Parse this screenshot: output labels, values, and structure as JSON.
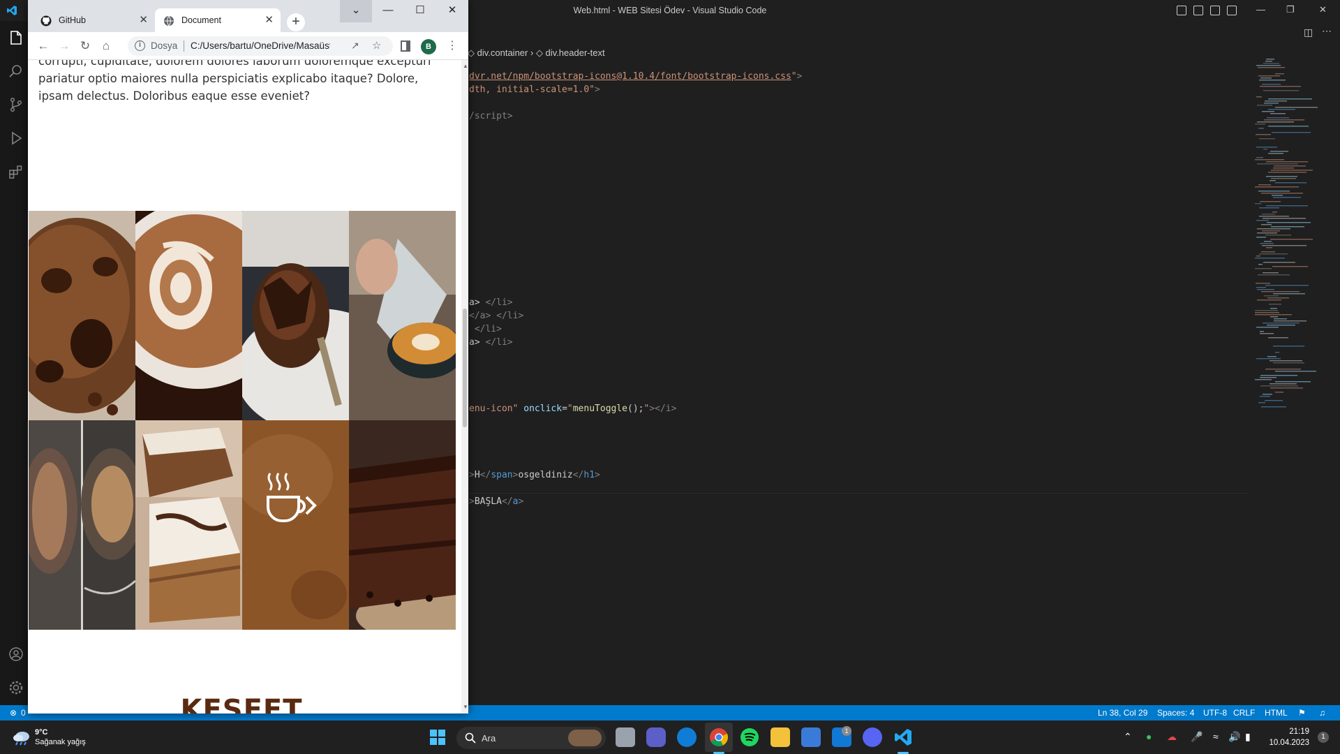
{
  "vscode": {
    "title": "Web.html - WEB Sitesi Ödev - Visual Studio Code",
    "breadcrumb": [
      "div.container",
      "div.header-text"
    ],
    "code_lines": [
      {
        "segments": [
          [
            "url",
            "dvr.net/npm/bootstrap-icons@1.10.4/font/bootstrap-icons.css"
          ],
          [
            "str",
            "\""
          ],
          [
            "tag",
            ">"
          ]
        ]
      },
      {
        "segments": [
          [
            "str",
            "dth, initial-scale=1.0\""
          ],
          [
            "tag",
            ">"
          ]
        ]
      },
      {
        "segments": [
          [
            "tag",
            "/script>"
          ]
        ]
      },
      {
        "segments": [
          [
            "plain",
            "a> "
          ],
          [
            "tag",
            "</li>"
          ]
        ]
      },
      {
        "segments": [
          [
            "tag",
            "</a> </li>"
          ]
        ]
      },
      {
        "segments": [
          [
            "tag",
            " </li>"
          ]
        ]
      },
      {
        "segments": [
          [
            "plain",
            "a> "
          ],
          [
            "tag",
            "</li>"
          ]
        ]
      },
      {
        "segments": [
          [
            "str",
            "enu-icon\" "
          ],
          [
            "attr",
            "onclick"
          ],
          [
            "plain",
            "="
          ],
          [
            "str",
            "\""
          ],
          [
            "fn",
            "menuToggle"
          ],
          [
            "plain",
            "();"
          ],
          [
            "str",
            "\""
          ],
          [
            "tag",
            "></i>"
          ]
        ]
      },
      {
        "segments": [
          [
            "tag",
            ">"
          ],
          [
            "plain",
            "H"
          ],
          [
            "tag",
            "</"
          ],
          [
            "blue",
            "span"
          ],
          [
            "tag",
            ">"
          ],
          [
            "plain",
            "osgeldiniz"
          ],
          [
            "tag",
            "</"
          ],
          [
            "blue",
            "h1"
          ],
          [
            "tag",
            ">"
          ]
        ]
      },
      {
        "segments": [
          [
            "tag",
            ">"
          ],
          [
            "plain",
            "BAŞLA"
          ],
          [
            "tag",
            "</"
          ],
          [
            "blue",
            "a"
          ],
          [
            "tag",
            ">"
          ]
        ]
      }
    ],
    "status": {
      "errors": "0",
      "position": "Ln 38, Col 29",
      "spaces": "Spaces: 4",
      "encoding": "UTF-8",
      "eol": "CRLF",
      "language": "HTML"
    }
  },
  "chrome": {
    "tabs": [
      {
        "label": "GitHub",
        "icon": "github-icon",
        "active": false
      },
      {
        "label": "Document",
        "icon": "globe-icon",
        "active": true
      }
    ],
    "omnibox": {
      "label": "Dosya",
      "url": "C:/Users/bartu/OneDrive/Masaüst..."
    },
    "avatar_letter": "B",
    "paragraph": "corrupti, cupiditate, dolorem dolores laborum doloremque excepturi pariatur optio maiores nulla perspiciatis explicabo itaque? Dolore, ipsam delectus. Doloribus eaque esse eveniet?",
    "gallery": [
      "cookie-photo",
      "latte-art-photo",
      "chocolate-cake-photo",
      "pour-coffee-photo",
      "coffee-glass-photo",
      "marble-cake-photo",
      "coffee-cup-tile",
      "layer-cake-photo"
    ],
    "section_heading": "KEŞFET"
  },
  "taskbar": {
    "weather_temp": "9°C",
    "weather_desc": "Sağanak yağış",
    "search_label": "Ara",
    "time": "21:19",
    "date": "10.04.2023",
    "notification_count": "1",
    "mail_badge": "1"
  },
  "colors": {
    "vscode_bg": "#1f1f1f",
    "statusbar": "#007acc",
    "taskbar": "#202020",
    "heading": "#5a2a10"
  }
}
